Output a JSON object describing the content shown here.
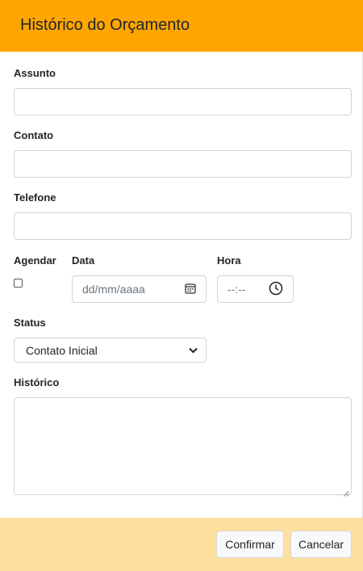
{
  "modal": {
    "title": "Histórico do Orçamento",
    "header_color": "#ffa500",
    "footer_color": "#ffe09f"
  },
  "form": {
    "assunto": {
      "label": "Assunto",
      "value": ""
    },
    "contato": {
      "label": "Contato",
      "value": ""
    },
    "telefone": {
      "label": "Telefone",
      "value": ""
    },
    "agendar": {
      "label": "Agendar",
      "checked": false
    },
    "data": {
      "label": "Data",
      "placeholder": "dd/mm/aaaa",
      "icon": "calendar-icon"
    },
    "hora": {
      "label": "Hora",
      "placeholder": "--:--",
      "icon": "clock-icon"
    },
    "status": {
      "label": "Status",
      "selected": "Contato Inicial"
    },
    "historico": {
      "label": "Histórico",
      "value": ""
    }
  },
  "footer": {
    "confirm_label": "Confirmar",
    "cancel_label": "Cancelar"
  }
}
